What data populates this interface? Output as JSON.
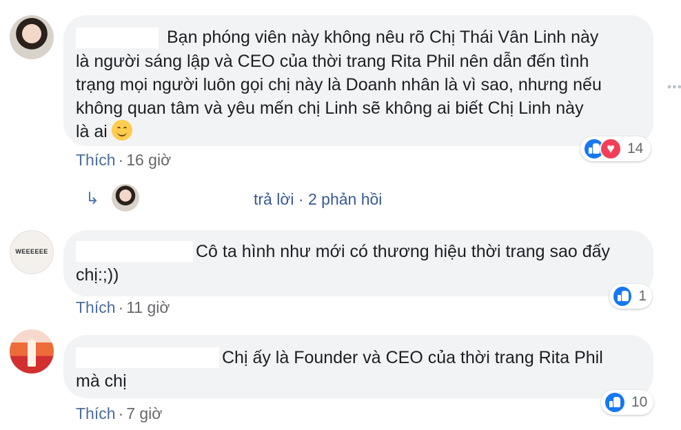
{
  "comments": [
    {
      "text_lines": [
        "Bạn phóng viên này không nêu rõ Chị Thái Vân Linh này",
        "là người sáng lập và CEO của thời trang Rita Phil nên dẫn đến tình",
        "trạng mọi người luôn gọi chị này là Doanh nhân là vì sao, nhưng nếu",
        "không quan tâm và yêu mến chị Linh sẽ không ai biết Chị Linh này",
        "là ai"
      ],
      "emoji": "smiling-face-icon",
      "like_label": "Thích",
      "time": "16 giờ",
      "reaction_count": "14",
      "reactions": [
        "like-icon",
        "love-icon"
      ]
    },
    {
      "text_lines": [
        "Cô ta hình như mới có thương hiệu thời trang sao đấy",
        "chị:;))"
      ],
      "avatar_text": "WEEEEEE",
      "like_label": "Thích",
      "time": "11 giờ",
      "reaction_count": "1",
      "reactions": [
        "like-icon"
      ]
    },
    {
      "text_lines": [
        "Chị ấy là Founder và CEO của thời trang Rita Phil",
        "mà chị"
      ],
      "like_label": "Thích",
      "time": "7 giờ",
      "reaction_count": "10",
      "reactions": [
        "like-icon"
      ]
    }
  ],
  "reply_summary": {
    "text": "trả lời · 2 phản hồi"
  },
  "separator": "·",
  "colors": {
    "bubble": "#f2f3f5",
    "link": "#385898",
    "meta": "#65676b",
    "like_blue": "#1877f2",
    "love_red": "#f33e58"
  }
}
